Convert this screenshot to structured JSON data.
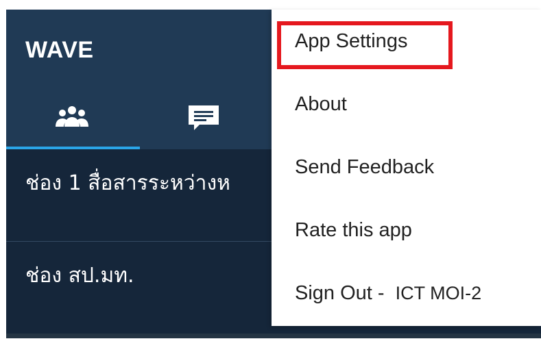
{
  "app": {
    "title": "WAVE",
    "tabs": [
      {
        "icon": "people-icon",
        "selected": true
      },
      {
        "icon": "chat-icon",
        "selected": false
      }
    ]
  },
  "channels": [
    {
      "label": "ช่อง 1 สื่อสารระหว่างห"
    },
    {
      "label": "ช่อง สป.มท."
    }
  ],
  "menu": {
    "items": [
      {
        "label": "App Settings"
      },
      {
        "label": "About"
      },
      {
        "label": "Send Feedback"
      },
      {
        "label": "Rate this app"
      },
      {
        "label": "Sign Out -",
        "account": "ICT MOI-2"
      }
    ]
  },
  "colors": {
    "header": "#203a55",
    "background": "#15263a",
    "tab_indicator": "#2aa5e8",
    "menu_background": "#ffffff",
    "highlight": "#e5181e"
  }
}
